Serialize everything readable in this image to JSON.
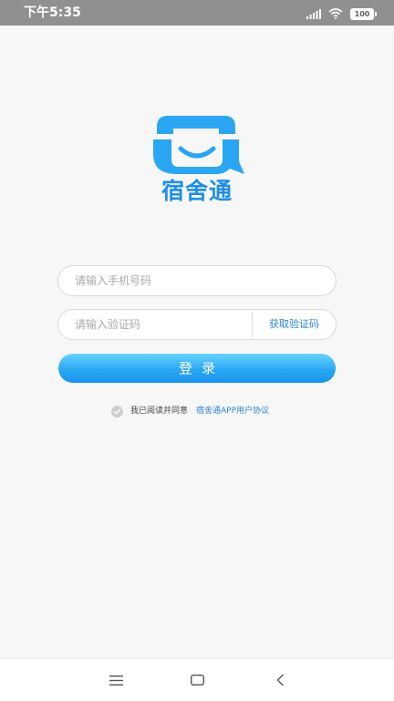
{
  "status_bar": {
    "time": "下午5:35",
    "battery": "100",
    "icons": [
      "signal-icon",
      "wifi-icon",
      "battery-icon"
    ]
  },
  "logo": {
    "app_name": "宿舍通",
    "icon": "phone-chat-logo-icon",
    "brand_color": "#1e8ee8"
  },
  "login_form": {
    "phone_placeholder": "请输入手机号码",
    "phone_value": "",
    "code_placeholder": "请输入验证码",
    "code_value": "",
    "get_code_label": "获取验证码",
    "login_label": "登录"
  },
  "agreement": {
    "checked": false,
    "text": "我已阅读并同意",
    "link_text": "宿舍通APP用户协议"
  },
  "colors": {
    "accent": "#2f86d6",
    "button_gradient_top": "#67d2ff",
    "button_gradient_bottom": "#1b93ec"
  },
  "nav_bar": {
    "icons": [
      "menu-icon",
      "home-icon",
      "back-icon"
    ]
  }
}
